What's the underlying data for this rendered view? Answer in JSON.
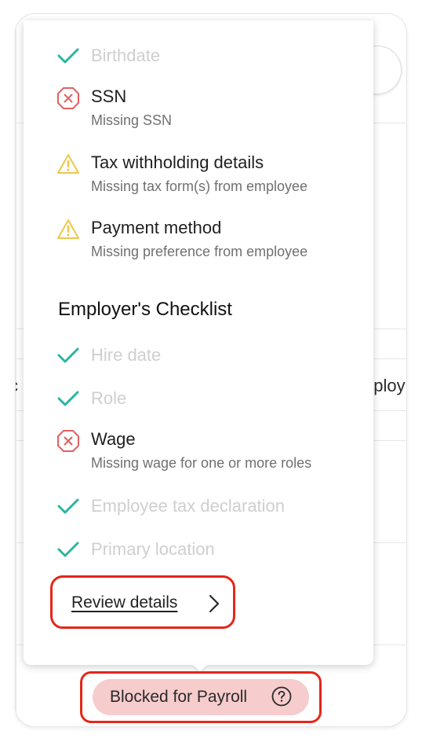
{
  "background": {
    "left_cut_text": "c",
    "right_cut_text": "nploy"
  },
  "employee_checklist": {
    "items": [
      {
        "title": "Birthdate",
        "status": "done",
        "icon": "check-icon"
      },
      {
        "title": "SSN",
        "subtitle": "Missing SSN",
        "status": "error",
        "icon": "error-octagon-icon"
      },
      {
        "title": "Tax withholding details",
        "subtitle": "Missing tax form(s) from employee",
        "status": "warning",
        "icon": "warning-triangle-icon"
      },
      {
        "title": "Payment method",
        "subtitle": "Missing preference from employee",
        "status": "warning",
        "icon": "warning-triangle-icon"
      }
    ]
  },
  "employer_checklist": {
    "heading": "Employer's Checklist",
    "items": [
      {
        "title": "Hire date",
        "status": "done",
        "icon": "check-icon"
      },
      {
        "title": "Role",
        "status": "done",
        "icon": "check-icon"
      },
      {
        "title": "Wage",
        "subtitle": "Missing wage for one or more roles",
        "status": "error",
        "icon": "error-octagon-icon"
      },
      {
        "title": "Employee tax declaration",
        "status": "done",
        "icon": "check-icon"
      },
      {
        "title": "Primary location",
        "status": "done",
        "icon": "check-icon"
      }
    ]
  },
  "review": {
    "label": "Review details",
    "icon": "chevron-right-icon"
  },
  "status_badge": {
    "label": "Blocked for Payroll",
    "icon": "help-circle-icon"
  },
  "colors": {
    "check": "#2bb5a0",
    "error": "#e06060",
    "warning": "#f0c64a",
    "highlight": "#e5261a",
    "badge_bg": "#f6cccc"
  }
}
